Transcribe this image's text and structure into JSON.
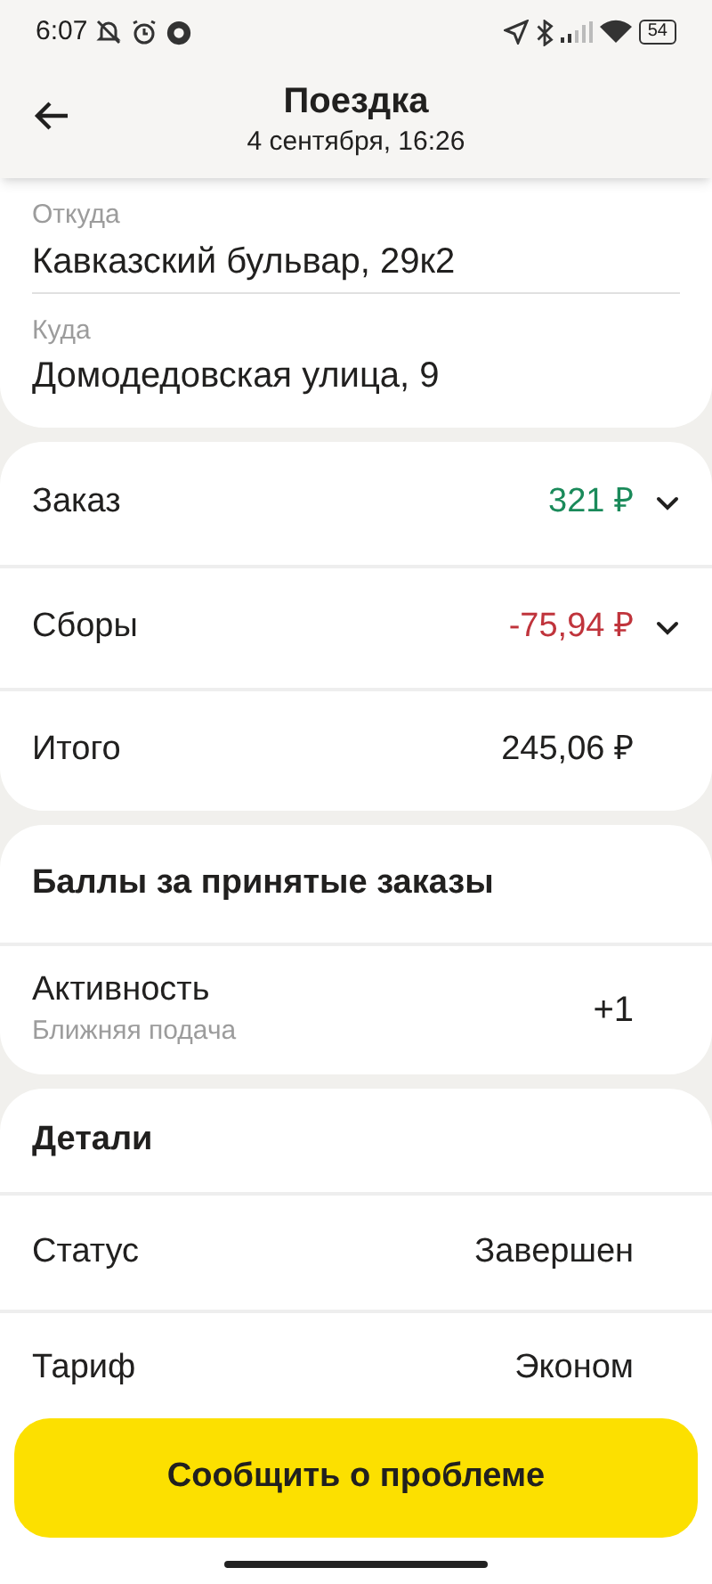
{
  "status_bar": {
    "time": "6:07",
    "battery": "54"
  },
  "header": {
    "title": "Поездка",
    "subtitle": "4 сентября, 16:26"
  },
  "route": [
    {
      "label": "Откуда",
      "value": "Кавказский бульвар, 29к2"
    },
    {
      "label": "Куда",
      "value": "Домодедовская улица, 9"
    }
  ],
  "payment": [
    {
      "label": "Заказ",
      "value": "321 ₽",
      "color": "#1a8a5a",
      "expandable": true
    },
    {
      "label": "Сборы",
      "value": "-75,94 ₽",
      "color": "#c0343c",
      "expandable": true
    },
    {
      "label": "Итого",
      "value": "245,06 ₽",
      "color": "#21201f",
      "expandable": false
    }
  ],
  "points": {
    "title": "Баллы за принятые заказы",
    "rows": [
      {
        "label": "Активность",
        "sublabel": "Ближняя подача",
        "value": "+1"
      }
    ]
  },
  "details": {
    "title": "Детали",
    "rows": [
      {
        "label": "Статус",
        "value": "Завершен"
      },
      {
        "label": "Тариф",
        "value": "Эконом"
      }
    ]
  },
  "action_button": "Сообщить о проблеме"
}
